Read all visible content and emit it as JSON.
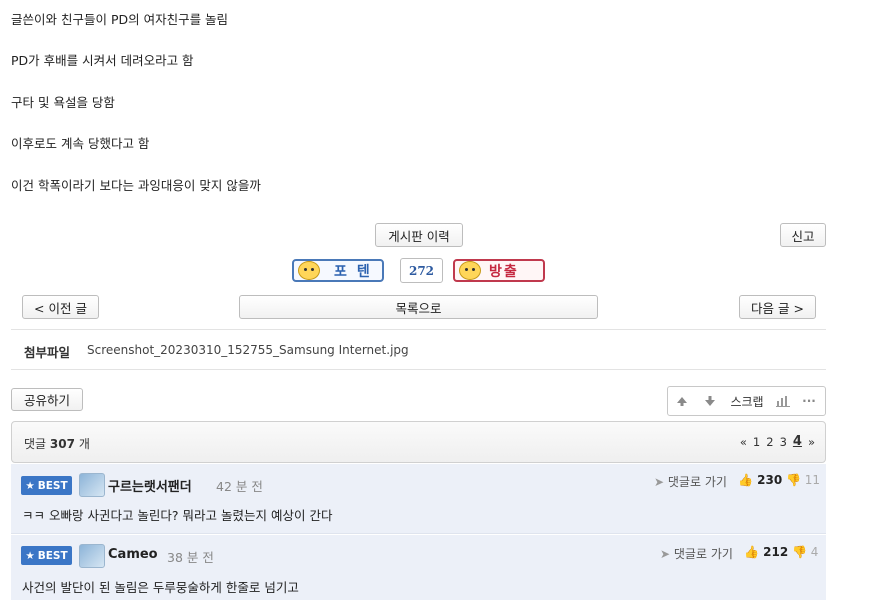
{
  "post": {
    "lines": [
      "글쓴이와 친구들이 PD의 여자친구를 놀림",
      "PD가 후배를 시켜서 데려오라고 함",
      "구타 및 욕설을 당함",
      "이후로도 계속 당했다고 함",
      "이건 학폭이라기 보다는 과잉대응이 맞지 않을까"
    ]
  },
  "actions": {
    "history_label": "게시판 이력",
    "report_label": "신고",
    "upvote_label": "포텐",
    "vote_count": "272",
    "downvote_label": "방출",
    "prev_label": "< 이전 글",
    "list_label": "목록으로",
    "next_label": "다음 글 >"
  },
  "attachment": {
    "label": "첨부파일",
    "filename": "Screenshot_20230310_152755_Samsung Internet.jpg"
  },
  "share": {
    "label": "공유하기"
  },
  "tools": {
    "scrap_label": "스크랩"
  },
  "comments": {
    "header_prefix": "댓글",
    "count": "307",
    "header_suffix": "개",
    "pager": {
      "first": "«",
      "pages": [
        "1",
        "2",
        "3"
      ],
      "current": "4",
      "last": "»"
    },
    "items": [
      {
        "badge": "BEST",
        "author": "구르는랫서팬더",
        "ago": "42 분 전",
        "reply_label": "댓글로 가기",
        "likes": "230",
        "dislikes": "11",
        "text": "ㅋㅋ 오빠랑 사귄다고 놀린다? 뭐라고 놀렸는지 예상이 간다"
      },
      {
        "badge": "BEST",
        "author": "Cameo",
        "ago": "38 분 전",
        "reply_label": "댓글로 가기",
        "likes": "212",
        "dislikes": "4",
        "text": "사건의 발단이 된 놀림은 두루뭉술하게 한줄로 넘기고"
      }
    ]
  }
}
